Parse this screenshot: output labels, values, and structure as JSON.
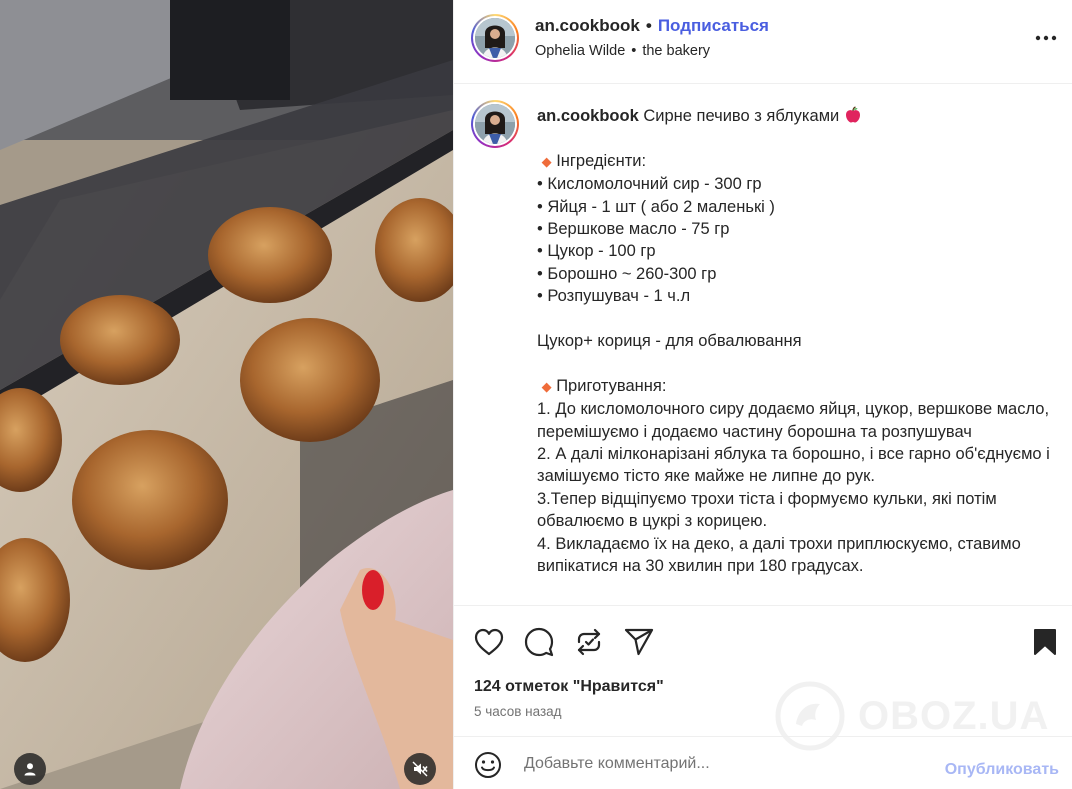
{
  "header": {
    "username": "an.cookbook",
    "separator": "•",
    "follow_label": "Подписаться",
    "audio": "Ophelia Wilde",
    "audio_separator": "•",
    "location": "the bakery",
    "more_icon": "more-horizontal-icon"
  },
  "caption": {
    "username": "an.cookbook",
    "title": "Сирне печиво з яблуками",
    "title_emoji": "apple-icon",
    "ingredients_heading": "Інгредієнти:",
    "ingredients": [
      "• Кисломолочний сир - 300 гр",
      "• Яйця - 1 шт ( або 2 маленькі )",
      "• Вершкове масло - 75 гр",
      "• Цукор - 100 гр",
      "• Борошно ~ 260-300 гр",
      "• Розпушувач - 1 ч.л"
    ],
    "coating": "Цукор+ кориця - для обвалювання",
    "steps_heading": "Приготування:",
    "steps": [
      "1. До кисломолочного сиру додаємо яйця, цукор, вершкове масло, перемішуємо і додаємо частину борошна та розпушувач",
      "2. А далі мілконарізані яблука та борошно, і все гарно об'єднуємо і замішуємо тісто яке майже не липне до рук.",
      "3.Тепер відщіпуємо трохи тіста і формуємо кульки, які потім обвалюємо в цукрі з корицею.",
      "4. Викладаємо їх на деко, а далі трохи приплюскуємо, ставимо випікатися на 30 хвилин при 180 градусах."
    ]
  },
  "actions": {
    "likes": "124 отметок \"Нравится\"",
    "time": "5 часов назад"
  },
  "comment": {
    "placeholder": "Добавьте комментарий...",
    "post_label": "Опубликовать"
  },
  "watermark": {
    "text": "OBOZ.UA"
  },
  "colors": {
    "follow": "#4a5ee0",
    "post_disabled": "#a8b7f5",
    "secondary_text": "#737373",
    "border": "#efefef"
  }
}
